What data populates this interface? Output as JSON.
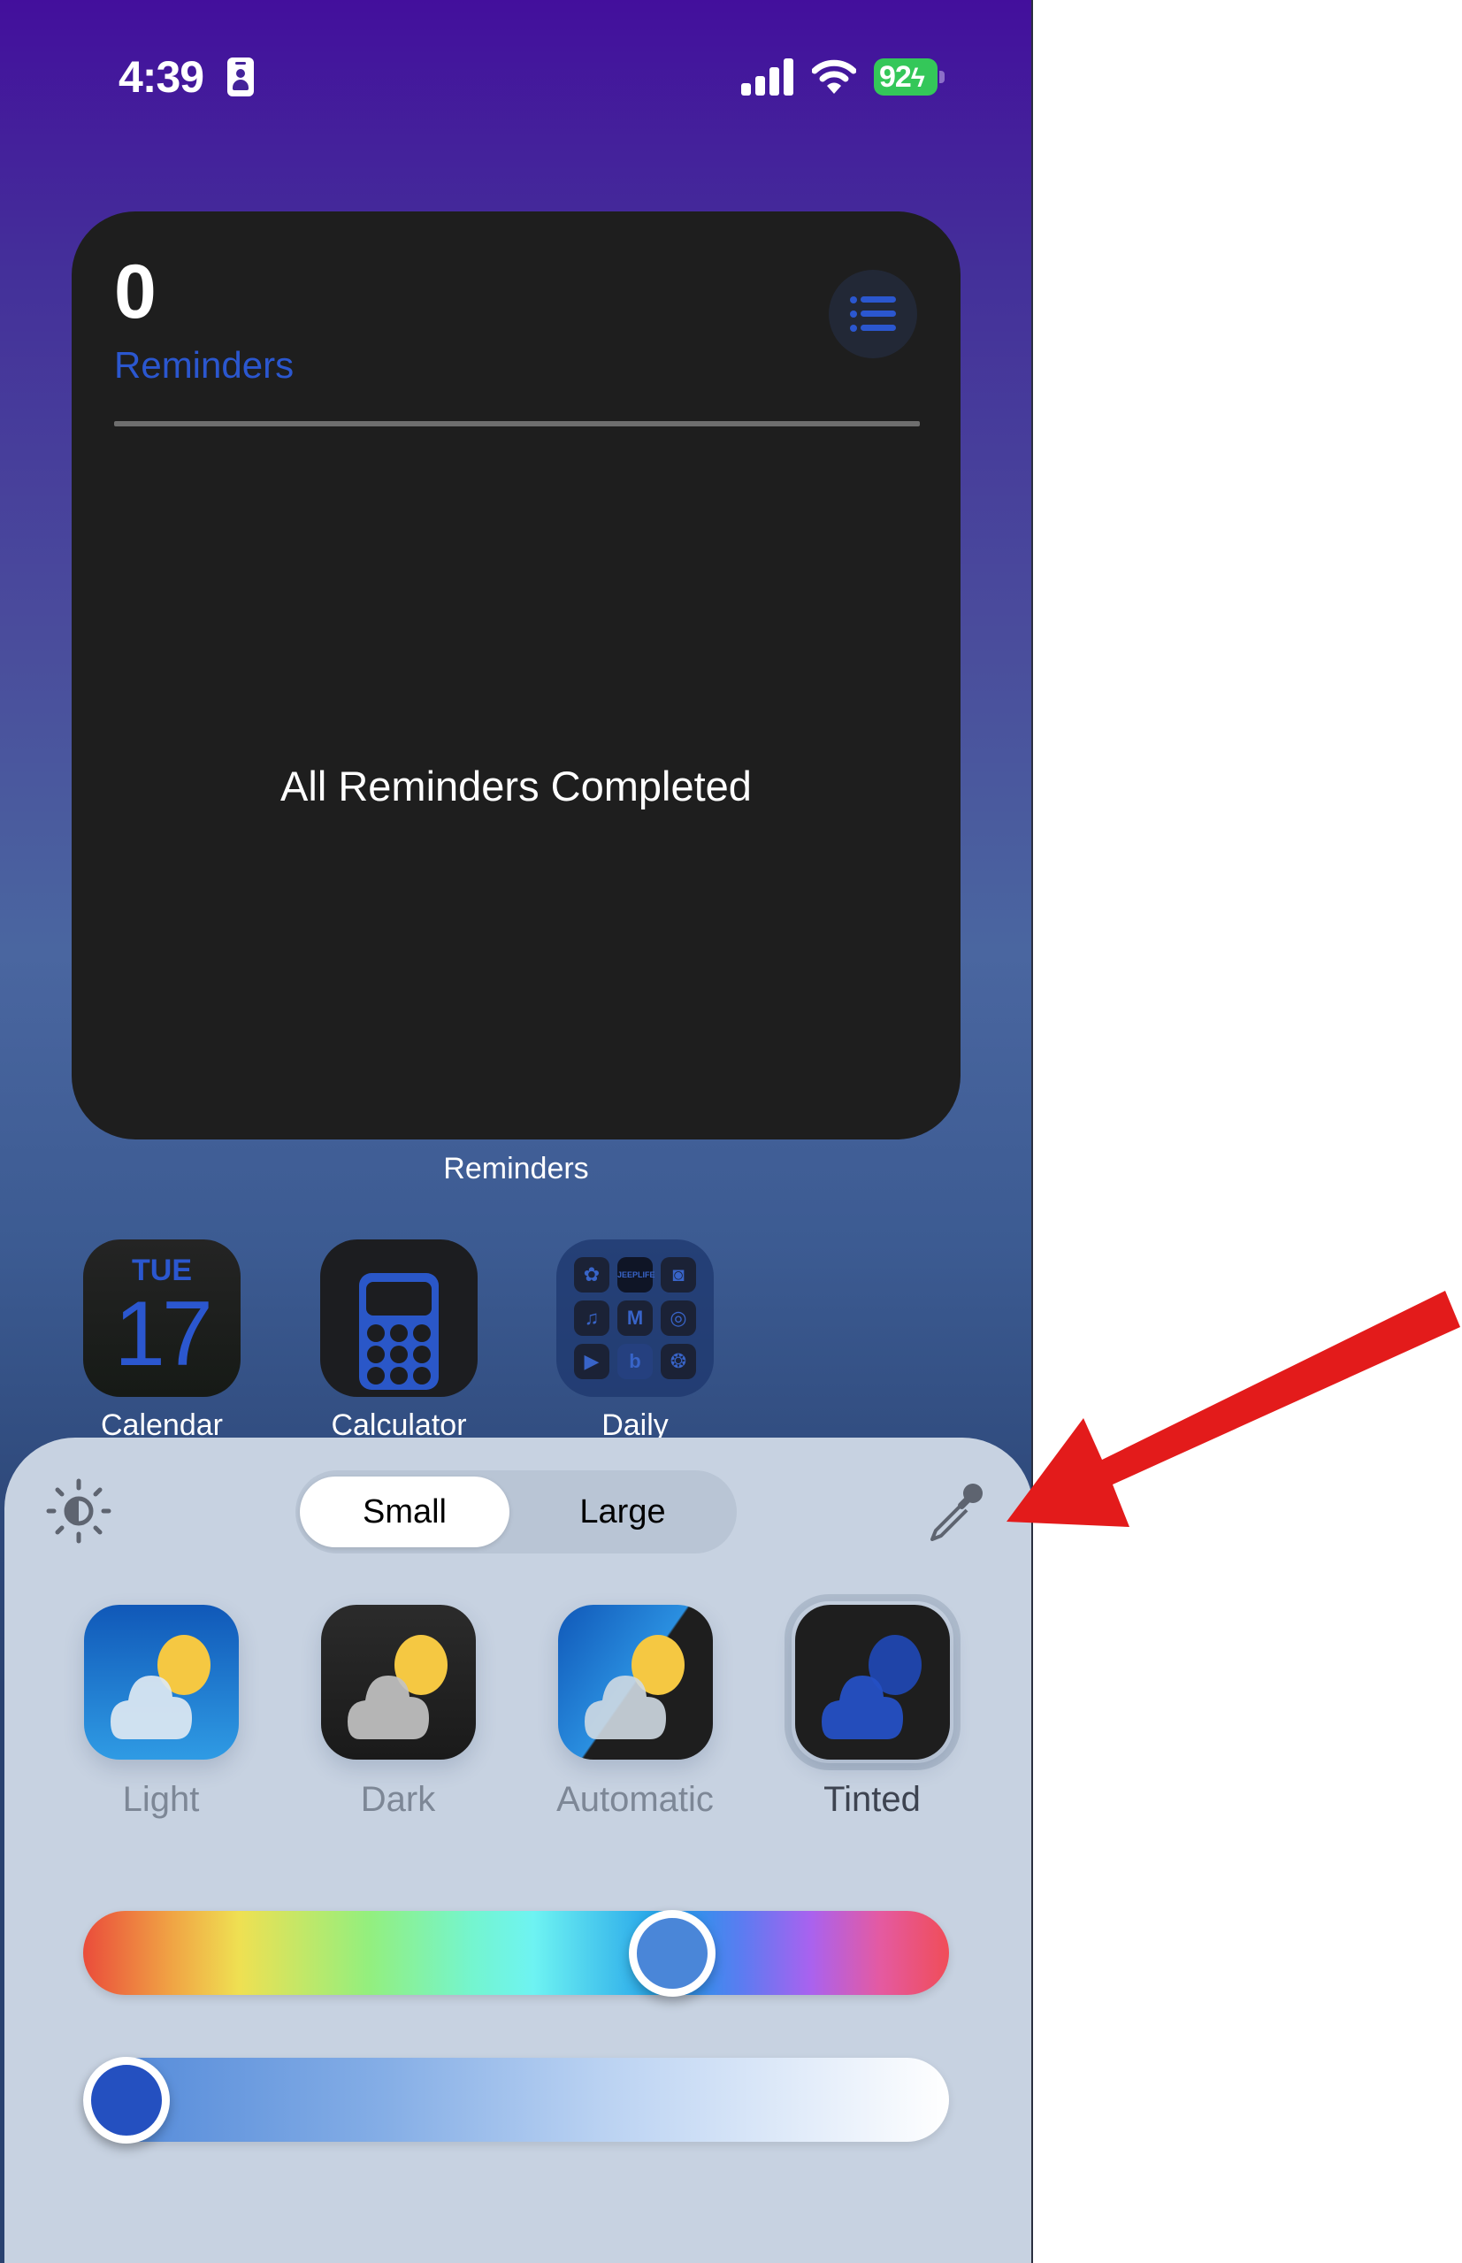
{
  "status_bar": {
    "time": "4:39",
    "focus_icon": "person-focus-icon",
    "signal_icon": "cellular-signal-icon",
    "wifi_icon": "wifi-icon",
    "battery_percent": "92",
    "battery_charging": true,
    "battery_color": "#34c759"
  },
  "widget": {
    "count": "0",
    "title": "Reminders",
    "list_icon": "list-bullet-icon",
    "empty_message": "All Reminders Completed",
    "label": "Reminders",
    "accent_color": "#2b57cf"
  },
  "apps": [
    {
      "label": "Calendar",
      "weekday": "TUE",
      "day": "17",
      "icon": "calendar-icon"
    },
    {
      "label": "Calculator",
      "icon": "calculator-icon"
    },
    {
      "label": "Daily",
      "icon": "folder-icon",
      "folder_items": [
        "flower-icon",
        "JEEPLIFE",
        "camera-icon",
        "music-icon",
        "M",
        "aperture-icon",
        "video-icon",
        "b",
        "openai-icon"
      ]
    }
  ],
  "customize_sheet": {
    "brightness_icon": "sun-contrast-icon",
    "size_options": [
      "Small",
      "Large"
    ],
    "selected_size": "Small",
    "eyedropper_icon": "eyedropper-icon",
    "styles": [
      {
        "label": "Light",
        "selected": false
      },
      {
        "label": "Dark",
        "selected": false
      },
      {
        "label": "Automatic",
        "selected": false
      },
      {
        "label": "Tinted",
        "selected": true
      }
    ],
    "hue_slider": {
      "value": 0.7,
      "thumb_color": "#4a86d8"
    },
    "saturation_slider": {
      "value": 0.0,
      "thumb_color": "#2450c0"
    }
  },
  "annotation": {
    "type": "red-arrow",
    "target": "eyedropper-icon",
    "color": "#e31b1b"
  }
}
